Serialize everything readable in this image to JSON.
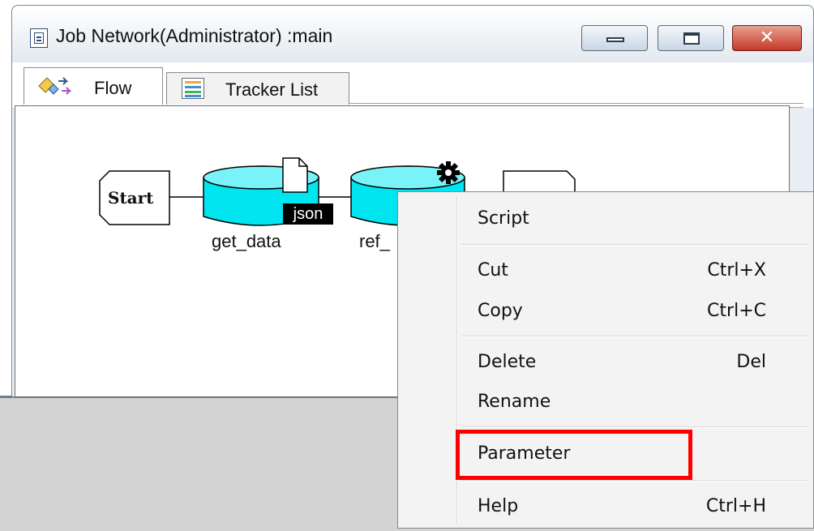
{
  "window": {
    "title": "Job Network(Administrator) :main",
    "close_glyph": "✕"
  },
  "tabs": [
    {
      "label": "Flow",
      "icon": "flow-icon",
      "active": true
    },
    {
      "label": "Tracker List",
      "icon": "tracker-list-icon",
      "active": false
    }
  ],
  "flow": {
    "start_label": "Start",
    "nodes": [
      {
        "label": "get_data",
        "badge": "json"
      },
      {
        "label": "ref_"
      }
    ]
  },
  "context_menu": {
    "items": [
      {
        "label": "Script",
        "shortcut": ""
      },
      {
        "label": "Cut",
        "shortcut": "Ctrl+X"
      },
      {
        "label": "Copy",
        "shortcut": "Ctrl+C"
      },
      {
        "label": "Delete",
        "shortcut": "Del"
      },
      {
        "label": "Rename",
        "shortcut": ""
      },
      {
        "label": "Parameter",
        "shortcut": ""
      },
      {
        "label": "Help",
        "shortcut": "Ctrl+H"
      }
    ],
    "highlighted_item": "Parameter"
  },
  "colors": {
    "job_node_fill": "#00e5ef",
    "highlight": "#ff0000"
  }
}
